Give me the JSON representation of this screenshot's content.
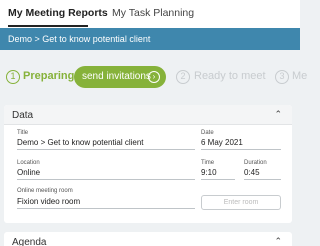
{
  "nav": {
    "tab_active": "My Meeting Reports",
    "tab_other": "My Task Planning"
  },
  "breadcrumb": "Demo > Get to know potential client",
  "steps": {
    "step1_num": "1",
    "step1_label": "Preparing",
    "invite_button": "send invitations",
    "step2_num": "2",
    "step2_label": "Ready to meet",
    "step3_num": "3",
    "step3_label": "Me"
  },
  "data_panel": {
    "title": "Data",
    "title_label": "Title",
    "title_value": "Demo > Get to know potential client",
    "date_label": "Date",
    "date_value": "6 May 2021",
    "location_label": "Location",
    "location_value": "Online",
    "time_label": "Time",
    "time_value": "9:10",
    "duration_label": "Duration",
    "duration_value": "0:45",
    "room_label": "Online meeting room",
    "room_value": "Fixion video room",
    "enter_room_button": "Enter room"
  },
  "agenda_panel": {
    "title": "Agenda"
  },
  "colors": {
    "accent_green": "#86b23a",
    "breadcrumb_blue": "#3f87ad"
  },
  "icons": {
    "invite_arrow": "arrow-right-circle-icon",
    "collapse": "chevron-up-icon"
  }
}
